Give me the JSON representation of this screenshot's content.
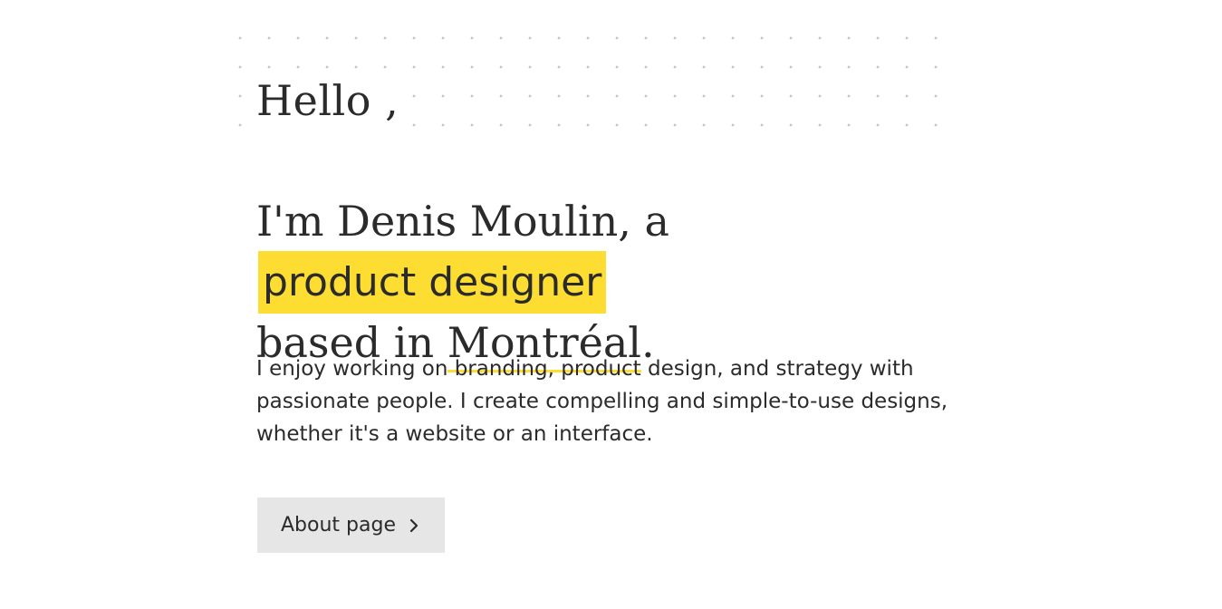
{
  "greeting": "Hello ,",
  "headline": {
    "intro": "I'm Denis Moulin, a",
    "role": "product designer",
    "location_prefix": "based in",
    "city": "Montréal",
    "period": "."
  },
  "intro_text": "I enjoy working on branding, product design, and strategy with passionate people. I create compelling and simple-to-use designs, whether it's a website or an interface.",
  "about_button": {
    "label": "About page",
    "icon": "chevron-right-icon"
  },
  "colors": {
    "accent": "#fedd33",
    "text": "#2b2b2b",
    "button_bg": "#e6e6e6"
  }
}
